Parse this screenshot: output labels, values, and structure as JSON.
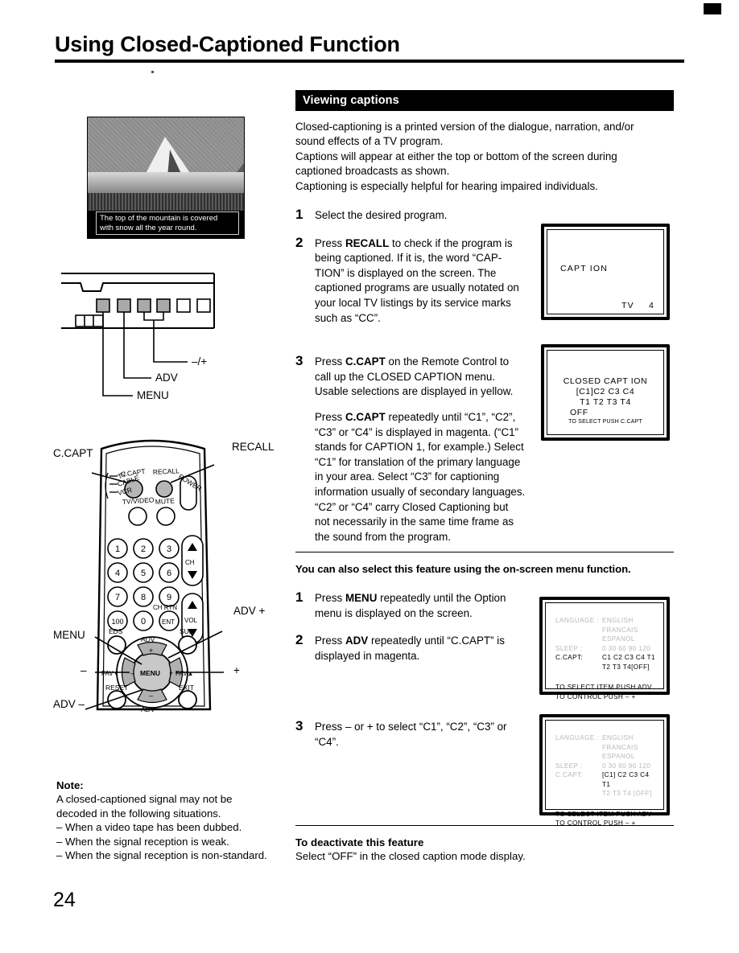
{
  "page": {
    "title": "Using Closed-Captioned Function",
    "number": "24"
  },
  "photo": {
    "caption_line1": "The top of the mountain is covered",
    "caption_line2": "with snow all the year round."
  },
  "panel_diagram": {
    "labels": {
      "plus_minus": "–/+",
      "adv": "ADV",
      "menu": "MENU"
    }
  },
  "remote": {
    "callouts": {
      "ccapt": "C.CAPT",
      "recall": "RECALL",
      "menu": "MENU",
      "adv_plus": "ADV +",
      "adv_minus": "ADV –",
      "minus": "–",
      "plus": "+"
    },
    "buttons": {
      "ccapt": "C.CAPT",
      "recall": "RECALL",
      "power": "POWER",
      "tv": "TV",
      "cable": "CABLE",
      "vcr": "VCR",
      "tvvideo": "TV/VIDEO",
      "mute": "MUTE",
      "ch": "CH",
      "vol": "VOL",
      "ch_rtn": "CH RTN",
      "ent": "ENT",
      "eds": "EDS",
      "sur": "SUR",
      "reset": "RESET",
      "exit": "EXIT",
      "fav_down": "FAV▼",
      "fav_up": "FAV▲",
      "adv_top": "ADV",
      "adv_bottom": "ADV",
      "menu_center": "MENU",
      "ring_plus": "+",
      "ring_minus": "–",
      "keypad": [
        "1",
        "2",
        "3",
        "4",
        "5",
        "6",
        "7",
        "8",
        "9",
        "100",
        "0"
      ]
    }
  },
  "note": {
    "title": "Note:",
    "line1": "A closed-captioned signal may not be",
    "line2": "decoded in the following situations.",
    "items": [
      "– When a video tape has been dubbed.",
      "– When the signal reception is weak.",
      "– When the signal reception is non-standard."
    ]
  },
  "viewing": {
    "heading": "Viewing captions",
    "intro_line1": "Closed-captioning is a printed version of the dialogue, narration, and/or",
    "intro_line2": "sound effects of a TV program.",
    "intro_line3": "Captions will appear at either the top or bottom of the screen during",
    "intro_line4": "captioned broadcasts as shown.",
    "intro_line5": "Captioning is especially helpful for hearing impaired individuals."
  },
  "steps_remote": [
    {
      "num": "1",
      "text": "Select the desired program."
    },
    {
      "num": "2",
      "text_pre": "Press ",
      "bold": "RECALL",
      "text_post": " to check if the program is being captioned. If it is, the word “CAP-TION” is displayed on the screen. The captioned programs are usually notated on your local TV listings by its service marks such as “CC”."
    },
    {
      "num": "3",
      "text_pre": "Press ",
      "bold": "C.CAPT",
      "text_post": " on the Remote Control to call up the CLOSED CAPTION menu. Usable selections are displayed in yellow.",
      "para2_pre": "Press ",
      "para2_bold": "C.CAPT",
      "para2_post": " repeatedly until “C1”, “C2”, “C3” or “C4” is displayed in magenta. (“C1” stands for CAPTION 1, for example.) Select “C1” for translation of the primary language in your area. Select “C3” for captioning information usually of secondary languages. “C2” or “C4” carry Closed Captioning but not necessarily in the same time frame as the sound from the program."
    }
  ],
  "tv_screens": {
    "recall": {
      "caption": "CAPT ION",
      "source": "TV",
      "channel": "4"
    },
    "closed_caption": {
      "title": "CLOSED  CAPT ION",
      "row1": "[C1]C2  C3  C4",
      "row2": "T1  T2  T3  T4",
      "row3": "OFF",
      "footer": "TO SELECT PUSH C.CAPT"
    },
    "option_menu_1": {
      "faded_row1_key": "LANGUAGE :",
      "faded_row1_val": "ENGLISH  FRANCAIS",
      "faded_row1_val2": "ESPANOL",
      "faded_row2_key": "SLEEP :",
      "faded_row2_val": "0  30  60  90  120",
      "ccapt_key": "C.CAPT:",
      "ccapt_val_line1": "C1  C2  C3  C4  T1",
      "ccapt_val_line2": "T2  T3  T4[OFF]",
      "footer1": "TO SELECT ITEM PUSH ADV",
      "footer2": "TO CONTROL PUSH – +"
    },
    "option_menu_2": {
      "faded_row1_key": "LANGUAGE :",
      "faded_row1_val": "ENGLISH  FRANCAIS",
      "faded_row1_val2": "ESPANOL",
      "faded_row2_key": "SLEEP :",
      "faded_row2_val": "0  30  60  90  120",
      "ccapt_key": "C.CAPT:",
      "ccapt_val_line1": "[C1]  C2  C3  C4  T1",
      "ccapt_val_line2": "T2  T3  T4 [OFF]",
      "footer1": "TO SELECT ITEM PUSH ADV",
      "footer2": "TO CONTROL PUSH – +"
    }
  },
  "onscreen": {
    "lead": "You can also select this feature using the on-screen menu function.",
    "steps": [
      {
        "num": "1",
        "pre": "Press ",
        "bold": "MENU",
        "post": " repeatedly until the Option menu is displayed on the screen."
      },
      {
        "num": "2",
        "pre": "Press ",
        "bold": "ADV",
        "post": " repeatedly until “C.CAPT” is displayed in magenta."
      },
      {
        "num": "3",
        "pre": "Press – or + to select “C1”, “C2”, “C3” or “C4”.",
        "bold": "",
        "post": ""
      }
    ]
  },
  "deactivate": {
    "title": "To deactivate this feature",
    "body": "Select “OFF” in the closed caption mode display."
  }
}
